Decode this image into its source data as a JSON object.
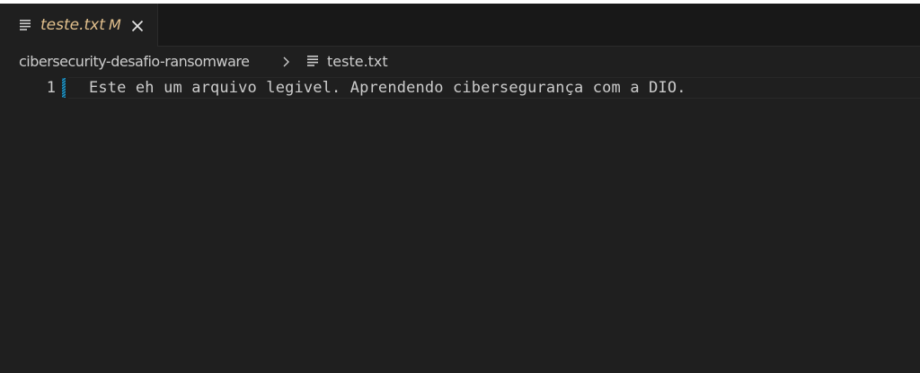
{
  "tab": {
    "title": "teste.txt",
    "modified_indicator": "M",
    "title_color": "#e2c08d",
    "file_icon": "lines-file-icon",
    "close_icon": "close-icon"
  },
  "breadcrumb": {
    "folder": "cibersecurity-desafio-ransomware",
    "separator_icon": "chevron-right-icon",
    "file_icon": "lines-file-icon",
    "file": "teste.txt"
  },
  "editor": {
    "lines": [
      {
        "number": "1",
        "text": "Este eh um arquivo legivel. Aprendendo cibersegurança com a DIO."
      }
    ],
    "gutter_modified_color": "#1b81a8",
    "background": "#1f1f1f",
    "text_color": "#cccccc"
  }
}
